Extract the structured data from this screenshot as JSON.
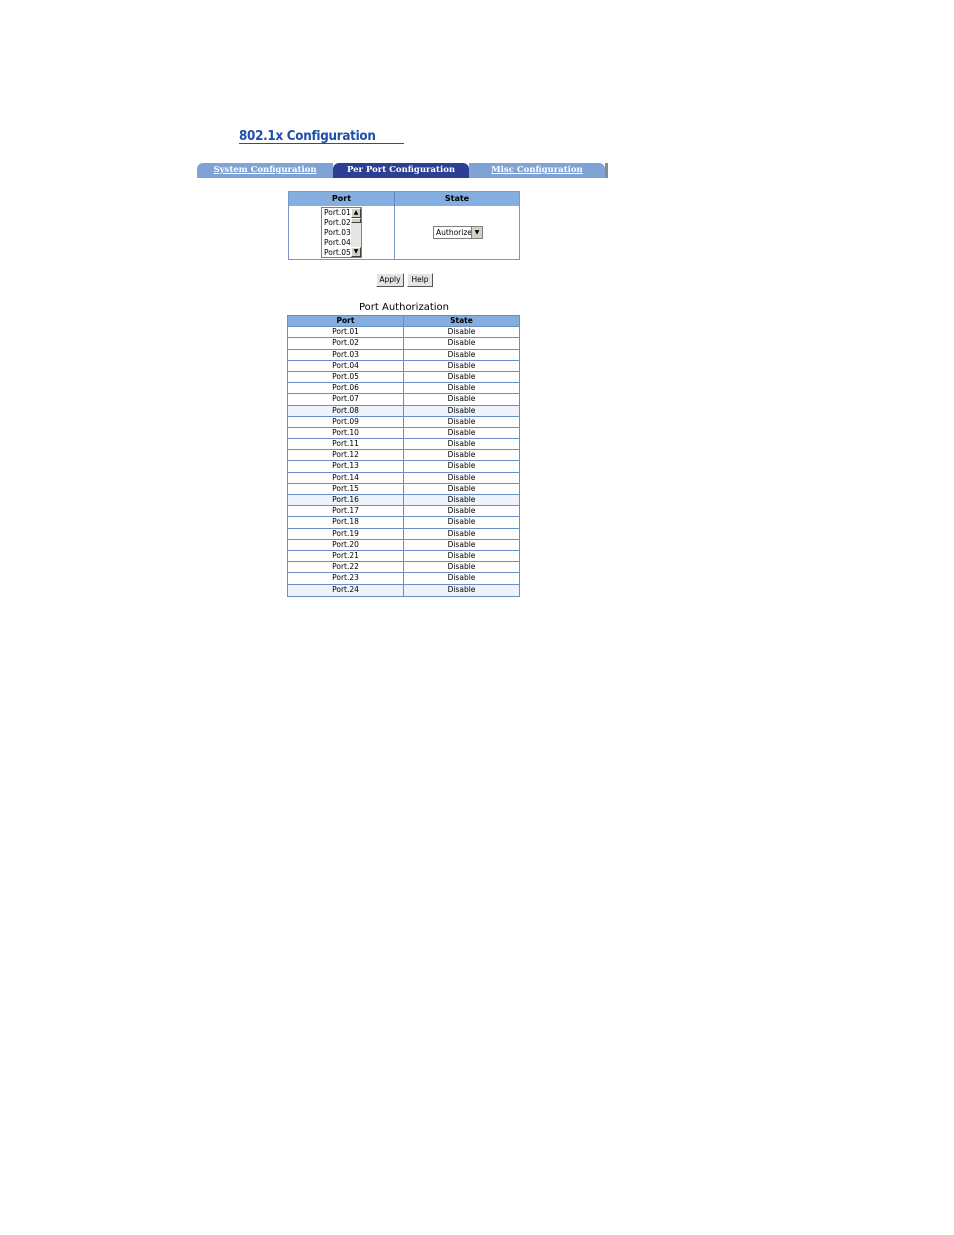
{
  "page_title": "802.1x Configuration",
  "tabs": [
    {
      "label": "System Configuration"
    },
    {
      "label": "Per Port Configuration"
    },
    {
      "label": "Misc Configuration"
    }
  ],
  "config": {
    "port_header": "Port",
    "state_header": "State",
    "port_options": [
      "Port.01",
      "Port.02",
      "Port.03",
      "Port.04",
      "Port.05"
    ],
    "selected_state": "Authorize"
  },
  "buttons": {
    "apply": "Apply",
    "help": "Help"
  },
  "authorization": {
    "title": "Port Authorization",
    "headers": {
      "port": "Port",
      "state": "State"
    },
    "rows": [
      {
        "port": "Port.01",
        "state": "Disable"
      },
      {
        "port": "Port.02",
        "state": "Disable"
      },
      {
        "port": "Port.03",
        "state": "Disable"
      },
      {
        "port": "Port.04",
        "state": "Disable"
      },
      {
        "port": "Port.05",
        "state": "Disable"
      },
      {
        "port": "Port.06",
        "state": "Disable"
      },
      {
        "port": "Port.07",
        "state": "Disable"
      },
      {
        "port": "Port.08",
        "state": "Disable"
      },
      {
        "port": "Port.09",
        "state": "Disable"
      },
      {
        "port": "Port.10",
        "state": "Disable"
      },
      {
        "port": "Port.11",
        "state": "Disable"
      },
      {
        "port": "Port.12",
        "state": "Disable"
      },
      {
        "port": "Port.13",
        "state": "Disable"
      },
      {
        "port": "Port.14",
        "state": "Disable"
      },
      {
        "port": "Port.15",
        "state": "Disable"
      },
      {
        "port": "Port.16",
        "state": "Disable"
      },
      {
        "port": "Port.17",
        "state": "Disable"
      },
      {
        "port": "Port.18",
        "state": "Disable"
      },
      {
        "port": "Port.19",
        "state": "Disable"
      },
      {
        "port": "Port.20",
        "state": "Disable"
      },
      {
        "port": "Port.21",
        "state": "Disable"
      },
      {
        "port": "Port.22",
        "state": "Disable"
      },
      {
        "port": "Port.23",
        "state": "Disable"
      },
      {
        "port": "Port.24",
        "state": "Disable"
      }
    ]
  }
}
